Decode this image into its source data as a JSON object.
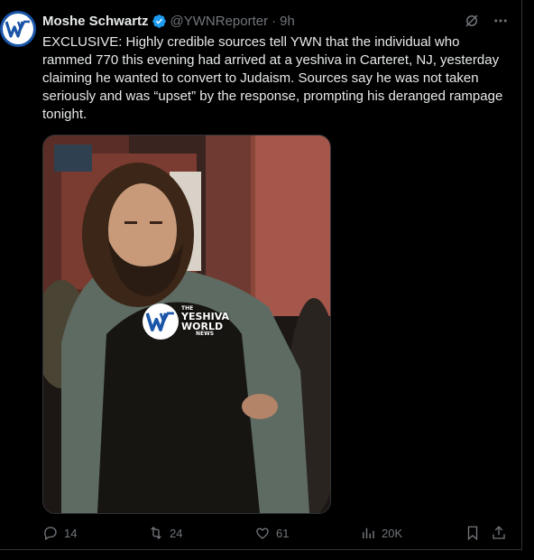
{
  "author": {
    "name": "Moshe Schwartz",
    "handle": "@YWNReporter",
    "separator": "·",
    "time": "9h",
    "avatar_icon": "ywn-logo-icon",
    "verified_icon": "verified-badge-icon"
  },
  "tweet": {
    "text": "EXCLUSIVE: Highly credible sources tell YWN that the individual who rammed 770 this evening had arrived at a yeshiva in Carteret, NJ, yesterday claiming he wanted to convert to Judaism. Sources say he was not taken seriously and was “upset” by the response, prompting his deranged rampage tonight."
  },
  "media": {
    "watermark": {
      "line1": "THE",
      "line2": "YESHIVA",
      "line3": "WORLD",
      "line4": "NEWS"
    }
  },
  "header_icons": [
    "grok-icon",
    "more-icon"
  ],
  "actions": {
    "reply_count": "14",
    "repost_count": "24",
    "like_count": "61",
    "views_count": "20K"
  },
  "colors": {
    "background": "#000000",
    "text": "#e7e9ea",
    "muted": "#71767b",
    "verified": "#1d9bf0",
    "border": "#2f3336"
  }
}
